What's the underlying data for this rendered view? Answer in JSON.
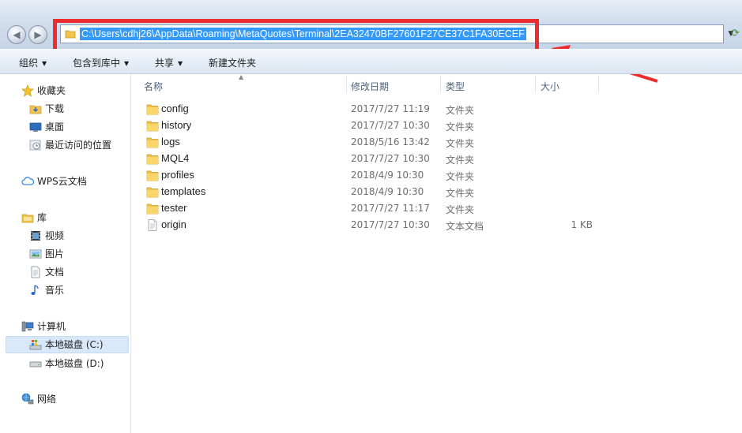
{
  "address_bar": {
    "path": "C:\\Users\\cdhj26\\AppData\\Roaming\\MetaQuotes\\Terminal\\2EA32470BF27601F27CE37C1FA30ECEF"
  },
  "toolbar": {
    "organize": "组织",
    "include_in_library": "包含到库中",
    "share": "共享",
    "new_folder": "新建文件夹"
  },
  "sidebar": {
    "favorites": "收藏夹",
    "downloads": "下载",
    "desktop": "桌面",
    "recent": "最近访问的位置",
    "wps": "WPS云文档",
    "libraries": "库",
    "videos": "视频",
    "pictures": "图片",
    "documents": "文档",
    "music": "音乐",
    "computer": "计算机",
    "drive_c": "本地磁盘 (C:)",
    "drive_d": "本地磁盘 (D:)",
    "network": "网络"
  },
  "columns": {
    "name": "名称",
    "date": "修改日期",
    "type": "类型",
    "size": "大小"
  },
  "files": [
    {
      "name": "config",
      "date": "2017/7/27 11:19",
      "type": "文件夹",
      "size": "",
      "kind": "folder"
    },
    {
      "name": "history",
      "date": "2017/7/27 10:30",
      "type": "文件夹",
      "size": "",
      "kind": "folder"
    },
    {
      "name": "logs",
      "date": "2018/5/16 13:42",
      "type": "文件夹",
      "size": "",
      "kind": "folder"
    },
    {
      "name": "MQL4",
      "date": "2017/7/27 10:30",
      "type": "文件夹",
      "size": "",
      "kind": "folder"
    },
    {
      "name": "profiles",
      "date": "2018/4/9 10:30",
      "type": "文件夹",
      "size": "",
      "kind": "folder"
    },
    {
      "name": "templates",
      "date": "2018/4/9 10:30",
      "type": "文件夹",
      "size": "",
      "kind": "folder"
    },
    {
      "name": "tester",
      "date": "2017/7/27 11:17",
      "type": "文件夹",
      "size": "",
      "kind": "folder"
    },
    {
      "name": "origin",
      "date": "2017/7/27 10:30",
      "type": "文本文档",
      "size": "1 KB",
      "kind": "text-file"
    }
  ],
  "colors": {
    "annotation": "#ec2d2d",
    "selection": "#3399ff",
    "folder": "#f2c34b"
  }
}
